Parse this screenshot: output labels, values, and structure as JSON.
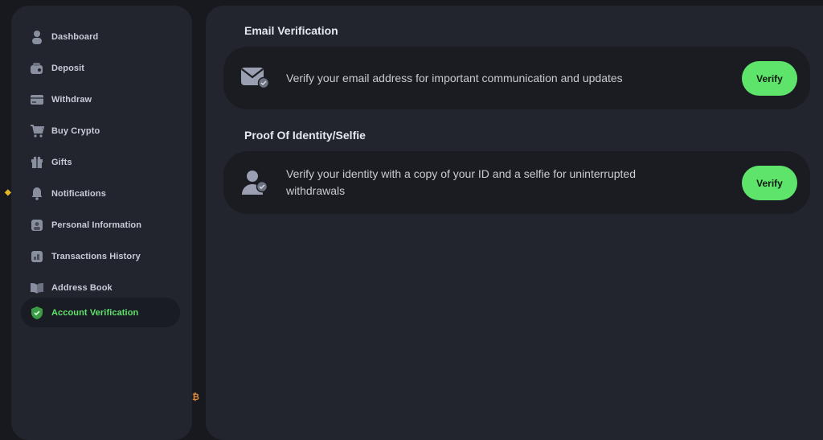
{
  "sidebar": {
    "items": [
      {
        "label": "Dashboard",
        "icon": "user-icon",
        "active": false
      },
      {
        "label": "Deposit",
        "icon": "wallet-icon",
        "active": false
      },
      {
        "label": "Withdraw",
        "icon": "card-icon",
        "active": false
      },
      {
        "label": "Buy Crypto",
        "icon": "cart-icon",
        "active": false
      },
      {
        "label": "Gifts",
        "icon": "gift-icon",
        "active": false
      },
      {
        "label": "Notifications",
        "icon": "bell-icon",
        "active": false
      },
      {
        "label": "Personal Information",
        "icon": "id-card-icon",
        "active": false
      },
      {
        "label": "Transactions History",
        "icon": "history-icon",
        "active": false
      },
      {
        "label": "Address Book",
        "icon": "book-icon",
        "active": false
      },
      {
        "label": "Account Verification",
        "icon": "shield-check-icon",
        "active": true
      }
    ]
  },
  "main": {
    "sections": [
      {
        "title": "Email Verification",
        "description": "Verify your email address for important communication and updates",
        "button_label": "Verify",
        "icon": "envelope-check-icon"
      },
      {
        "title": "Proof Of Identity/Selfie",
        "description": "Verify your identity with a copy of your ID and a selfie for uninterrupted withdrawals",
        "button_label": "Verify",
        "icon": "user-check-icon"
      }
    ]
  },
  "colors": {
    "accent": "#5ee36b",
    "background": "#17191f",
    "panel": "#22252e",
    "card": "#1a1c22"
  }
}
